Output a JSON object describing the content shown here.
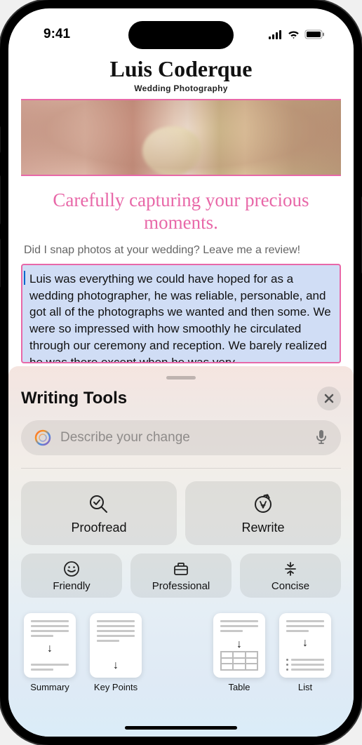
{
  "status": {
    "time": "9:41"
  },
  "document": {
    "brand_name": "Luis Coderque",
    "brand_subtitle": "Wedding Photography",
    "tagline": "Carefully capturing your precious moments.",
    "prompt": "Did I snap photos at your wedding? Leave me a review!",
    "selected_text": "Luis was everything we could have hoped for as a wedding photographer, he was reliable, personable, and got all of the photographs we wanted and then some. We were so impressed with how smoothly he circulated through our ceremony and reception. We barely realized he was there except when he was very"
  },
  "panel": {
    "title": "Writing Tools",
    "placeholder": "Describe your change",
    "proofread": "Proofread",
    "rewrite": "Rewrite",
    "friendly": "Friendly",
    "professional": "Professional",
    "concise": "Concise",
    "summary": "Summary",
    "key_points": "Key Points",
    "table": "Table",
    "list": "List"
  }
}
